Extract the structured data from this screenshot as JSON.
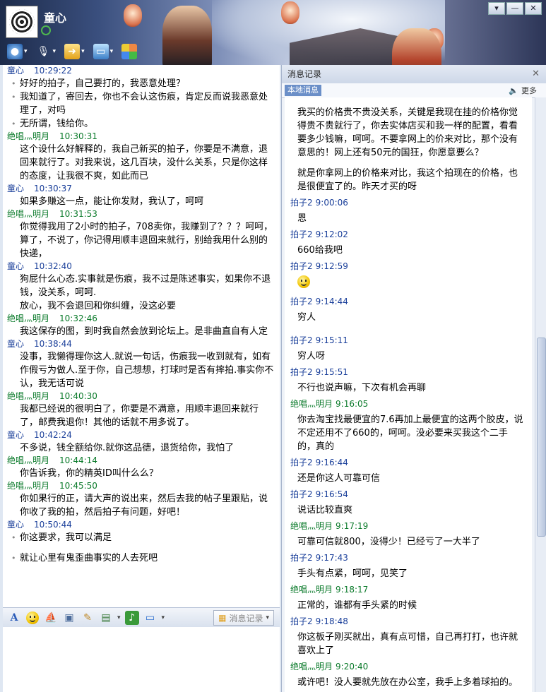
{
  "header": {
    "nickname": "童心"
  },
  "window_controls": {
    "menu": "▾",
    "minimize": "—",
    "close": "✕"
  },
  "chat": {
    "messages": [
      {
        "sender": "童心",
        "time": "10:29:22",
        "self": true,
        "lines": [
          "好好的拍子，自己要打的，我恶意处理？",
          "我知道了，寄回去，你也不会认这伤痕，肯定反而说我恶意处理了，对吗",
          "无所谓，钱给你。"
        ],
        "dots": true
      },
      {
        "sender": "绝唱灬明月",
        "time": "10:30:31",
        "self": false,
        "lines": [
          "这个设什么好解释的，我自己新买的拍子，你要是不满意，退回来就行了。对我来说，这几百块，没什么关系，只是你这样的态度，让我很不爽，如此而已"
        ]
      },
      {
        "sender": "童心",
        "time": "10:30:37",
        "self": true,
        "lines": [
          "如果多赚这一点，能让你发财，我认了，呵呵"
        ]
      },
      {
        "sender": "绝唱灬明月",
        "time": "10:31:53",
        "self": false,
        "lines": [
          "你觉得我用了2小时的拍子，708卖你，我赚到了？？？呵呵，算了，不说了，你记得用顺丰退回来就行，别给我用什么别的快递，"
        ]
      },
      {
        "sender": "童心",
        "time": "10:32:40",
        "self": true,
        "lines": [
          "狗屁什么心态.实事就是伤痕，我不过是陈述事实，如果你不退钱，没关系，呵呵.",
          "放心，我不会退回和你纠缠，没这必要"
        ]
      },
      {
        "sender": "绝唱灬明月",
        "time": "10:32:46",
        "self": false,
        "lines": [
          "我这保存的图，到时我自然会放到论坛上。是非曲直自有人定"
        ]
      },
      {
        "sender": "童心",
        "time": "10:38:44",
        "self": true,
        "lines": [
          "没事，我懒得理你这人.就说一句话，伤痕我一收到就有，如有作假亏为做人.至于你，自己想想，打球时是否有摔拍.事实你不认，我无话可说"
        ]
      },
      {
        "sender": "绝唱灬明月",
        "time": "10:40:30",
        "self": false,
        "lines": [
          "我都已经说的很明白了，你要是不满意，用顺丰退回来就行了，邮费我退你！其他的话就不用多说了。"
        ]
      },
      {
        "sender": "童心",
        "time": "10:42:24",
        "self": true,
        "lines": [
          "不多说，钱全额给你.就你这品德，退货给你，我怕了"
        ]
      },
      {
        "sender": "绝唱灬明月",
        "time": "10:44:14",
        "self": false,
        "lines": [
          "你告诉我，你的精英ID叫什么么？"
        ]
      },
      {
        "sender": "绝唱灬明月",
        "time": "10:45:50",
        "self": false,
        "lines": [
          "你如果行的正，请大声的说出来，然后去我的帖子里跟贴，说你收了我的拍，然后拍子有问题，好吧！"
        ]
      },
      {
        "sender": "童心",
        "time": "10:50:44",
        "self": true,
        "lines": [
          "你这要求，我可以满足",
          "",
          "就让心里有鬼歪曲事实的人去死吧"
        ],
        "dots": true
      }
    ]
  },
  "chat_toolbar": {
    "history_label": "消息记录"
  },
  "history": {
    "title": "消息记录",
    "tab_local": "本地消息",
    "more_label": "更多",
    "close": "✕",
    "messages": [
      {
        "sender": "",
        "time": "",
        "self": false,
        "lines": [
          "我买的价格贵不贵没关系，关键是我现在挂的价格你觉得贵不贵就行了，你去实体店买和我一样的配置，看看要多少钱嘛，呵呵。不要拿网上的价来对比，那个没有意思的！网上还有50元的国狂，你愿意要么？",
          "",
          "就是你拿网上的价格来对比，我这个拍现在的价格，也是很便宜了的。昨天才买的呀"
        ]
      },
      {
        "sender": "拍子2",
        "time": "9:00:06",
        "self": true,
        "lines": [
          "恩"
        ]
      },
      {
        "sender": "拍子2",
        "time": "9:12:02",
        "self": true,
        "lines": [
          "660给我吧"
        ]
      },
      {
        "sender": "拍子2",
        "time": "9:12:59",
        "self": true,
        "emoji": true,
        "lines": []
      },
      {
        "sender": "拍子2",
        "time": "9:14:44",
        "self": true,
        "lines": [
          "穷人",
          ""
        ]
      },
      {
        "sender": "拍子2",
        "time": "9:15:11",
        "self": true,
        "lines": [
          "穷人呀"
        ]
      },
      {
        "sender": "拍子2",
        "time": "9:15:51",
        "self": true,
        "lines": [
          "不行也说声嘛，下次有机会再聊"
        ]
      },
      {
        "sender": "绝唱灬明月",
        "time": "9:16:05",
        "self": false,
        "lines": [
          "你去淘宝找最便宜的7.6再加上最便宜的这两个胶皮，说不定还用不了660的，呵呵。没必要来买我这个二手的，真的"
        ]
      },
      {
        "sender": "拍子2",
        "time": "9:16:44",
        "self": true,
        "lines": [
          "还是你这人可靠可信"
        ]
      },
      {
        "sender": "拍子2",
        "time": "9:16:54",
        "self": true,
        "lines": [
          "说话比较直爽"
        ]
      },
      {
        "sender": "绝唱灬明月",
        "time": "9:17:19",
        "self": false,
        "lines": [
          "可靠可信就800，没得少！已经亏了一大半了"
        ]
      },
      {
        "sender": "拍子2",
        "time": "9:17:43",
        "self": true,
        "lines": [
          "手头有点紧，呵呵，见笑了"
        ]
      },
      {
        "sender": "绝唱灬明月",
        "time": "9:18:17",
        "self": false,
        "lines": [
          "正常的，谁都有手头紧的时候"
        ]
      },
      {
        "sender": "拍子2",
        "time": "9:18:48",
        "self": true,
        "lines": [
          "你这板子刚买就出，真有点可惜，自己再打打，也许就喜欢上了"
        ]
      },
      {
        "sender": "绝唱灬明月",
        "time": "9:20:40",
        "self": false,
        "lines": [
          "或许吧！没人要就先放在办公室，我手上多着球拍的。"
        ]
      }
    ]
  },
  "colors": {
    "self_name": "#1a3f9a",
    "other_name": "#0a7a2a",
    "header_dark": "#1d2b4a",
    "tab_active": "#6b8fc8"
  },
  "icons": [
    "avatar-swirl",
    "status-online-icon",
    "camera-icon",
    "microphone-icon",
    "transfer-file-icon",
    "screen-share-icon",
    "apps-grid-icon",
    "font-icon",
    "smiley-icon",
    "nudge-icon",
    "screenshot-icon",
    "handwrite-icon",
    "picture-icon",
    "music-icon",
    "remote-icon",
    "history-icon",
    "speaker-icon",
    "close-icon"
  ]
}
